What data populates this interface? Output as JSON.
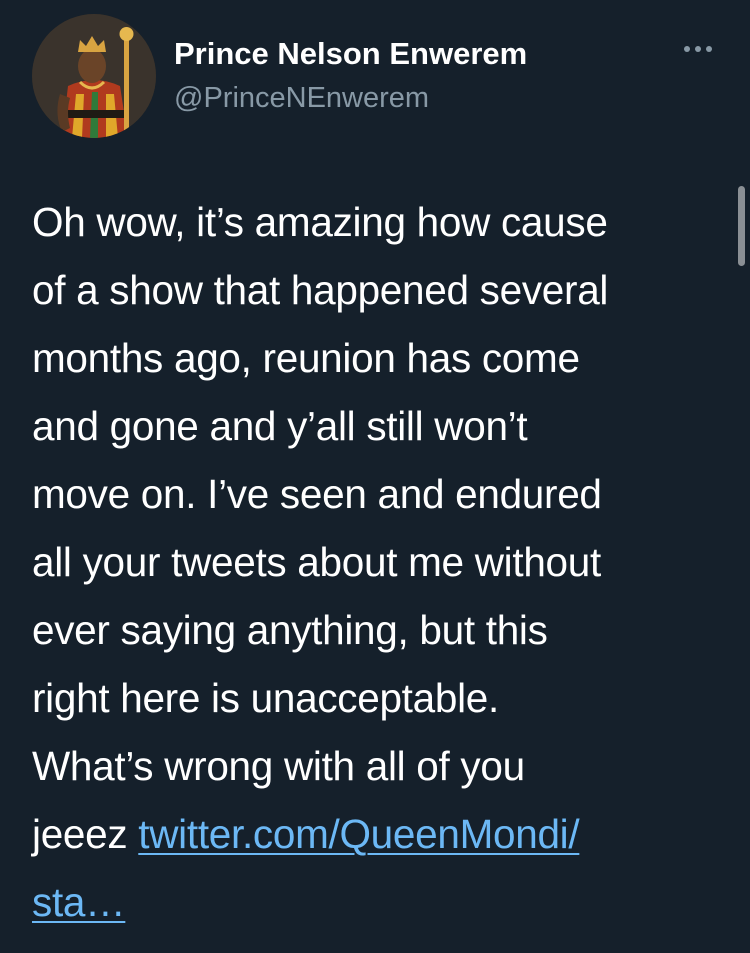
{
  "author": {
    "display_name": "Prince Nelson Enwerem",
    "handle": "@PrinceNEnwerem",
    "avatar_icon": "profile-photo"
  },
  "more_icon": "more-horizontal-icon",
  "tweet": {
    "lines": [
      "Oh wow, it’s amazing how cause",
      "of a show that happened several",
      "months ago, reunion has come",
      "and gone and y’all still won’t",
      "move on. I’ve seen and endured",
      "all your tweets about me without",
      "ever saying anything, but this",
      "right here is unacceptable.",
      "What’s wrong with all of you"
    ],
    "last_line_prefix": "jeeez ",
    "link_part1": "twitter.com/QueenMondi/",
    "link_part2": "sta…"
  },
  "colors": {
    "background": "#15202b",
    "text": "#ffffff",
    "secondary": "#8899a6",
    "link": "#6cb8f5"
  }
}
